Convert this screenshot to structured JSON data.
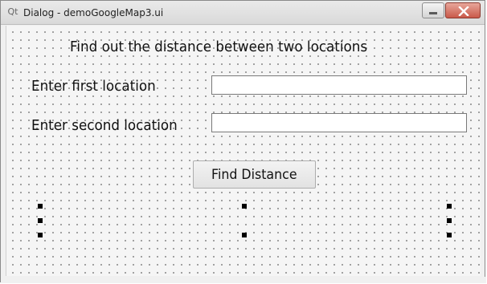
{
  "window": {
    "title": "Dialog - demoGoogleMap3.ui",
    "app_icon": "Qt",
    "minimize_icon": "minimize-icon",
    "close_icon": "close-icon"
  },
  "form": {
    "heading": "Find out the distance between two locations",
    "first_label": "Enter first location",
    "first_value": "",
    "second_label": "Enter second location",
    "second_value": "",
    "button_label": "Find Distance"
  }
}
